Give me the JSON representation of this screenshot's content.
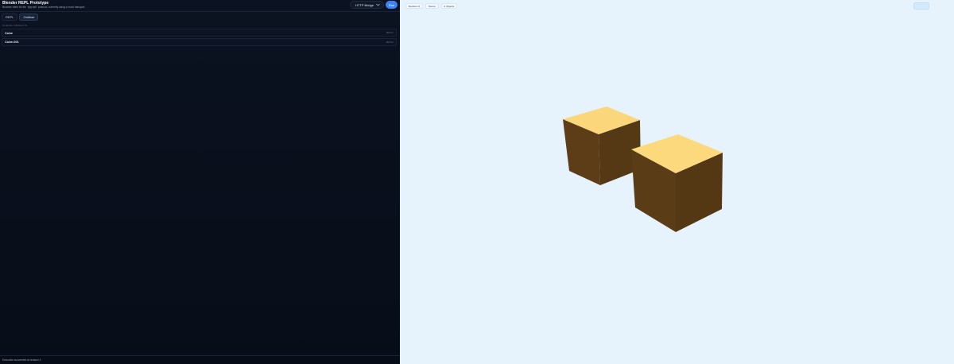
{
  "header": {
    "title": "Blender REPL Prototype",
    "subtitle": "Browser client for the `bpy.repl` protocol, currently using a mock transport.",
    "transport_selected": "HTTP Bridge",
    "run_label": "Run"
  },
  "tabs": [
    {
      "label": "REPL",
      "active": false
    },
    {
      "label": "Outliner",
      "active": true
    }
  ],
  "outliner": {
    "section_label": "SCENE OBJECTS",
    "objects": [
      {
        "name": "Cube",
        "type": "MESH"
      },
      {
        "name": "Cube.001",
        "type": "MESH"
      }
    ]
  },
  "status": {
    "text": "Execution succeeded at revision 3"
  },
  "viewport": {
    "chips": [
      "Revision 3",
      "Scene",
      "2 Objects"
    ],
    "background_color": "#e6f3fd",
    "cube_top_color": "#fcd67a",
    "cube_side_color": "#5c3d17"
  }
}
